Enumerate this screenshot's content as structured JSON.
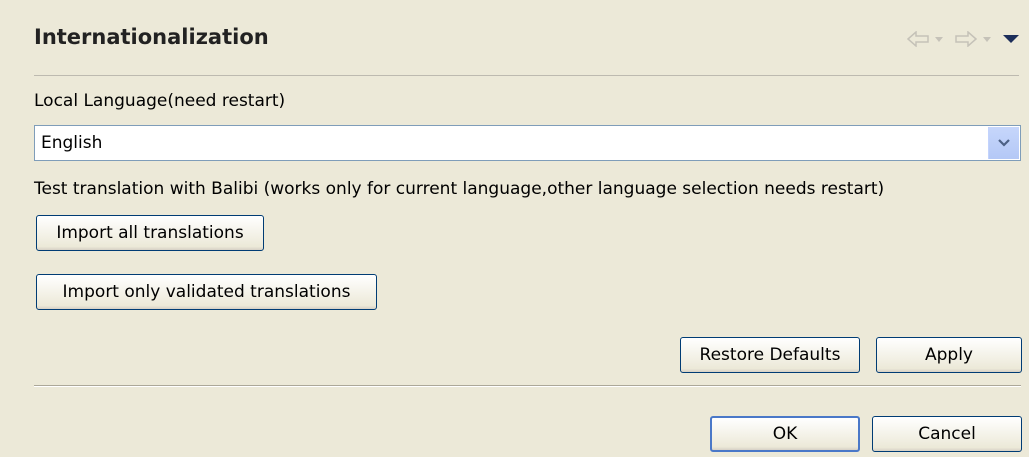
{
  "header": {
    "title": "Internationalization",
    "nav_icons": [
      "back-arrow-icon",
      "back-menu-icon",
      "forward-arrow-icon",
      "forward-menu-icon",
      "view-menu-icon"
    ]
  },
  "language": {
    "label": "Local Language(need restart)",
    "selected": "English"
  },
  "translation": {
    "note": "Test translation with Balibi (works only for current language,other language selection needs restart)",
    "import_all_label": "Import all translations",
    "import_validated_label": "Import only validated translations"
  },
  "page_buttons": {
    "restore_defaults": "Restore Defaults",
    "apply": "Apply"
  },
  "dialog_buttons": {
    "ok": "OK",
    "cancel": "Cancel"
  },
  "colors": {
    "background": "#ece9d8",
    "button_border": "#003c74",
    "focus_border": "#4a78c8"
  }
}
